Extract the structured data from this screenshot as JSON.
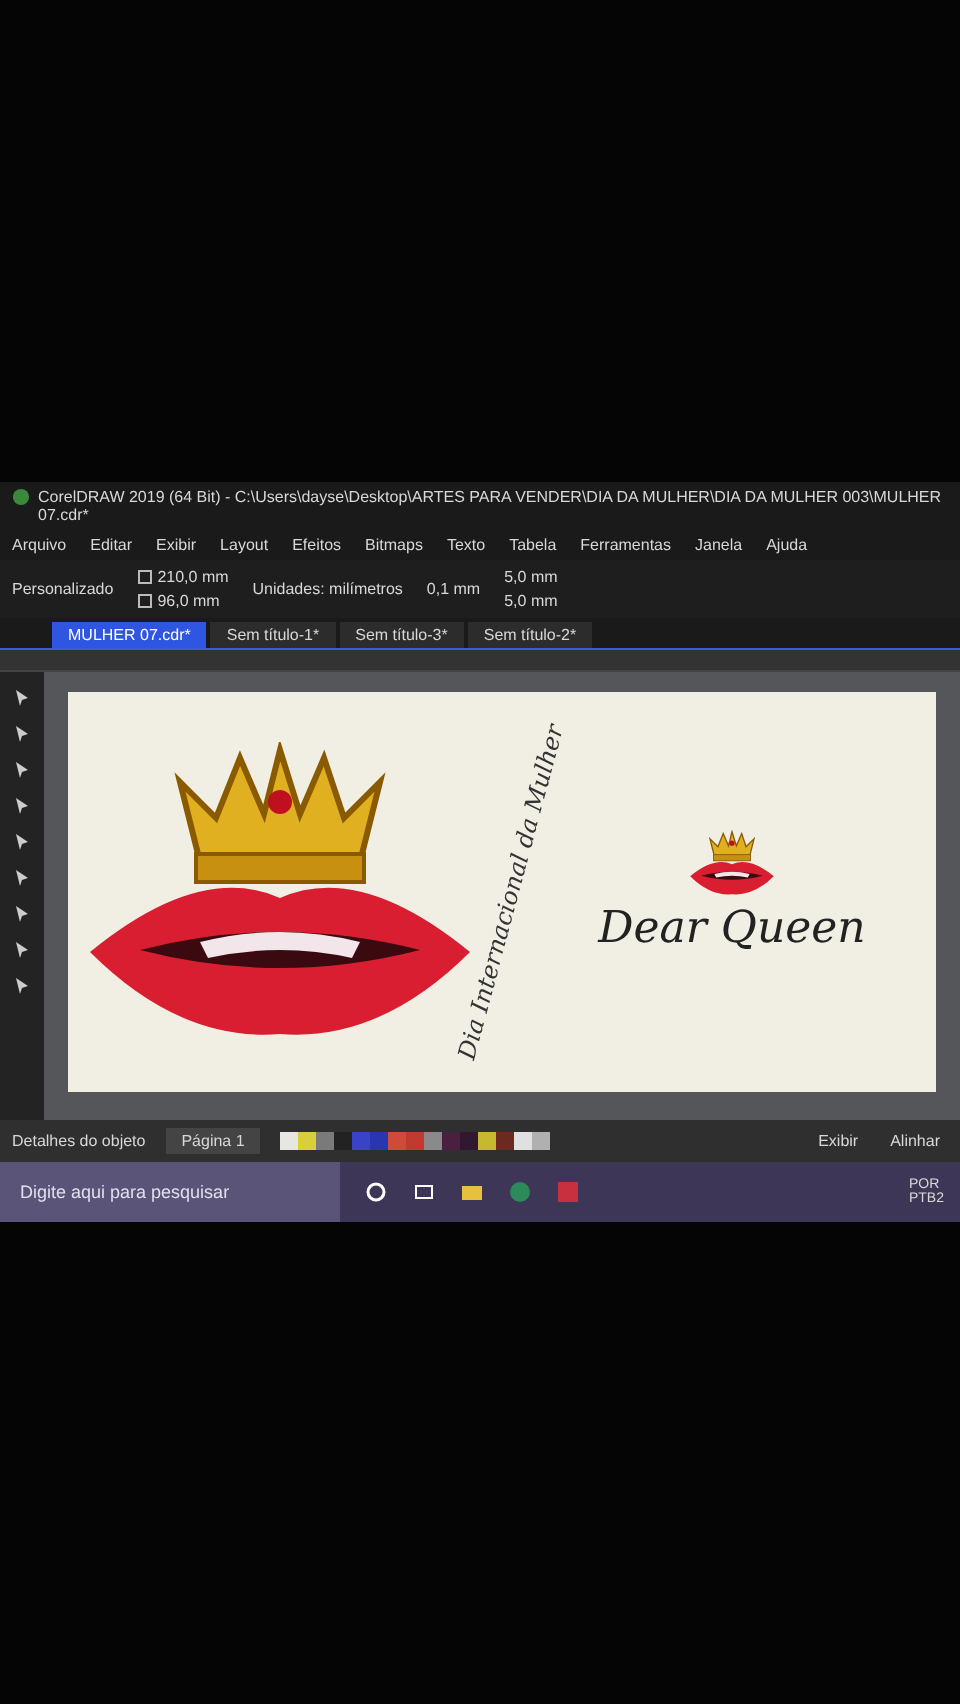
{
  "window": {
    "title": "CorelDRAW 2019 (64 Bit) - C:\\Users\\dayse\\Desktop\\ARTES PARA VENDER\\DIA DA MULHER\\DIA DA MULHER 003\\MULHER 07.cdr*"
  },
  "menu": [
    "Arquivo",
    "Editar",
    "Exibir",
    "Layout",
    "Efeitos",
    "Bitmaps",
    "Texto",
    "Tabela",
    "Ferramentas",
    "Janela",
    "Ajuda"
  ],
  "property_bar": {
    "page_size": "Personalizado",
    "width": "210,0 mm",
    "height": "96,0 mm",
    "units": "Unidades: milímetros",
    "nudge": "0,1 mm",
    "duplicate_x": "5,0 mm",
    "duplicate_y": "5,0 mm"
  },
  "document_tabs": [
    {
      "label": "MULHER 07.cdr*",
      "selected": true
    },
    {
      "label": "Sem título-1*",
      "selected": false
    },
    {
      "label": "Sem título-3*",
      "selected": false
    },
    {
      "label": "Sem título-2*",
      "selected": false
    }
  ],
  "canvas": {
    "side_text": "Dia Internacional da Mulher",
    "title": "Dear Queen"
  },
  "panel": {
    "label": "Detalhes do objeto"
  },
  "page_tab": "Página 1",
  "palette": [
    {
      "color": "#e8e6e0"
    },
    {
      "color": "#d8cf3a"
    },
    {
      "color": "#7a7a7a"
    },
    {
      "color": "#222222"
    },
    {
      "color": "#3a42c8"
    },
    {
      "color": "#2a35b0"
    },
    {
      "color": "#d04a3a"
    },
    {
      "color": "#c03a30"
    },
    {
      "color": "#8a8a8a"
    },
    {
      "color": "#4a2040"
    },
    {
      "color": "#301830"
    },
    {
      "color": "#c8b830"
    },
    {
      "color": "#6a2a20"
    },
    {
      "color": "#e0e0e0"
    },
    {
      "color": "#b0b0b0"
    }
  ],
  "status_bar": {
    "view": "Exibir",
    "align": "Alinhar"
  },
  "taskbar": {
    "search_placeholder": "Digite aqui para pesquisar",
    "language": "POR",
    "layout": "PTB2"
  }
}
